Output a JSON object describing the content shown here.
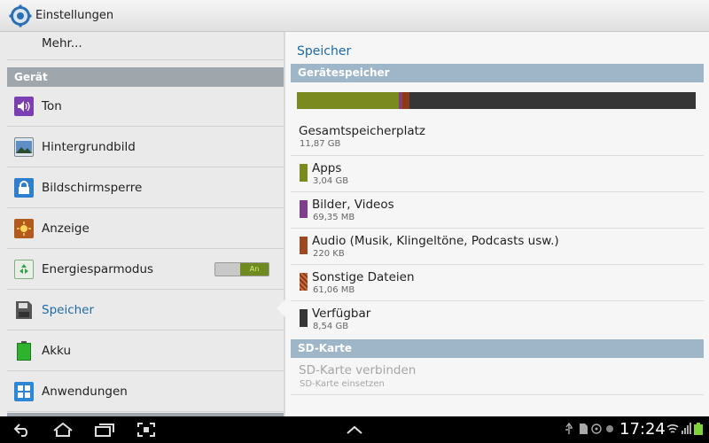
{
  "window": {
    "title": "Einstellungen"
  },
  "sidebar": {
    "more_label": "Mehr...",
    "section_label": "Gerät",
    "items": [
      {
        "label": "Ton",
        "icon": "sound-icon",
        "color": "#7a3fb3"
      },
      {
        "label": "Hintergrundbild",
        "icon": "wallpaper-icon",
        "color": "#3f77b7"
      },
      {
        "label": "Bildschirmsperre",
        "icon": "lock-icon",
        "color": "#2e7fd0"
      },
      {
        "label": "Anzeige",
        "icon": "display-icon",
        "color": "#b35b1e"
      },
      {
        "label": "Energiesparmodus",
        "icon": "power-saving-icon",
        "color": "#2fa34a"
      },
      {
        "label": "Speicher",
        "icon": "storage-icon",
        "color": "#555555"
      },
      {
        "label": "Akku",
        "icon": "battery-icon",
        "color": "#2fb32f"
      },
      {
        "label": "Anwendungen",
        "icon": "apps-icon",
        "color": "#2e86d6"
      }
    ],
    "power_toggle_label": "An",
    "selected": "Speicher"
  },
  "main": {
    "title": "Speicher",
    "device_header": "Gerätespeicher",
    "usage_bar": [
      {
        "name": "Apps",
        "fraction": 0.256,
        "color": "#7a8a1e"
      },
      {
        "name": "Bilder, Videos",
        "fraction": 0.006,
        "color": "#7d3f8c"
      },
      {
        "name": "Audio",
        "fraction": 0.002,
        "color": "#9a4a1e"
      },
      {
        "name": "Sonstige Dateien",
        "fraction": 0.018,
        "color": "#8a3a1a"
      },
      {
        "name": "Verfügbar",
        "fraction": 0.718,
        "color": "#363636"
      }
    ],
    "total": {
      "label": "Gesamtspeicherplatz",
      "value": "11,87 GB"
    },
    "rows": [
      {
        "label": "Apps",
        "value": "3,04 GB",
        "color": "#7a8a1e"
      },
      {
        "label": "Bilder, Videos",
        "value": "69,35 MB",
        "color": "#7d3f8c"
      },
      {
        "label": "Audio (Musik, Klingeltöne, Podcasts usw.)",
        "value": "220 KB",
        "color": "#9a4a1e"
      },
      {
        "label": "Sonstige Dateien",
        "value": "61,06 MB",
        "color": "#8a3a1a"
      },
      {
        "label": "Verfügbar",
        "value": "8,54 GB",
        "color": "#363636"
      }
    ],
    "sd_header": "SD-Karte",
    "sd_connect": {
      "label": "SD-Karte verbinden",
      "sub": "SD-Karte einsetzen"
    }
  },
  "navbar": {
    "time": "17:24"
  }
}
